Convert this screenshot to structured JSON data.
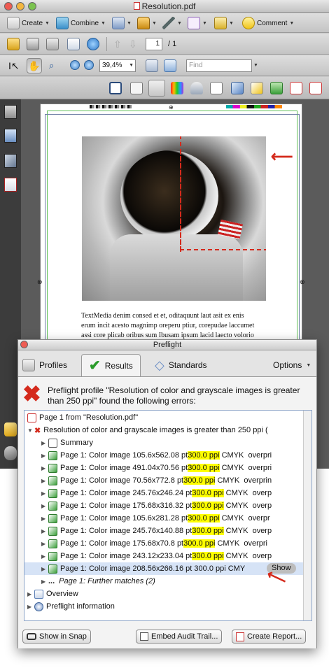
{
  "window": {
    "title": "Resolution.pdf"
  },
  "toolbar1": {
    "create": "Create",
    "combine": "Combine",
    "comment": "Comment"
  },
  "toolbar2": {
    "page_current": "1",
    "page_total": "/ 1"
  },
  "toolbar3": {
    "zoom": "39,4%",
    "find_placeholder": "Find"
  },
  "document": {
    "body_text": "TextMedia denim consed et et, oditaquunt laut asit ex enis erum incit acesto magnimp oreperu ptiur, corepudae laccumet assi core plicab oribus sum Ibusam ipsum lacid laecto volorio nobis milent voluptam idipitiae mollam nobiliam persperciis"
  },
  "preflight": {
    "title": "Preflight",
    "tabs": [
      "Profiles",
      "Results",
      "Standards"
    ],
    "options_label": "Options",
    "message": "Preflight profile \"Resolution of color and grayscale images is greater than 250 ppi\" found the following errors:",
    "tree": {
      "root": "Page 1 from \"Resolution.pdf\"",
      "rule": "Resolution of color and grayscale images is greater than 250 ppi (",
      "summary": "Summary",
      "items": [
        {
          "prefix": "Page 1: Color image 105.6x562.08 pt ",
          "ppi": "300.0 ppi",
          "suffix": " CMYK  overpri"
        },
        {
          "prefix": "Page 1: Color image 491.04x70.56 pt ",
          "ppi": "300.0 ppi",
          "suffix": " CMYK  overpri"
        },
        {
          "prefix": "Page 1: Color image 70.56x772.8 pt ",
          "ppi": "300.0 ppi",
          "suffix": " CMYK  overprin"
        },
        {
          "prefix": "Page 1: Color image 245.76x246.24 pt ",
          "ppi": "300.0 ppi",
          "suffix": " CMYK  overp"
        },
        {
          "prefix": "Page 1: Color image 175.68x316.32 pt ",
          "ppi": "300.0 ppi",
          "suffix": " CMYK  overp"
        },
        {
          "prefix": "Page 1: Color image 105.6x281.28 pt ",
          "ppi": "300.0 ppi",
          "suffix": " CMYK  overpr"
        },
        {
          "prefix": "Page 1: Color image 245.76x140.88 pt ",
          "ppi": "300.0 ppi",
          "suffix": " CMYK  overp"
        },
        {
          "prefix": "Page 1: Color image 175.68x70.8 pt ",
          "ppi": "300.0 ppi",
          "suffix": " CMYK  overpri"
        },
        {
          "prefix": "Page 1: Color image 243.12x233.04 pt ",
          "ppi": "300.0 ppi",
          "suffix": " CMYK  overp"
        }
      ],
      "selected_item": "Page 1: Color image 208.56x266.16 pt 300.0 ppi CMY",
      "show_label": "Show",
      "further": "Page 1: Further matches (2)",
      "overview": "Overview",
      "info": "Preflight information"
    },
    "buttons": {
      "snap": "Show in Snap",
      "audit": "Embed Audit Trail...",
      "report": "Create Report..."
    }
  }
}
